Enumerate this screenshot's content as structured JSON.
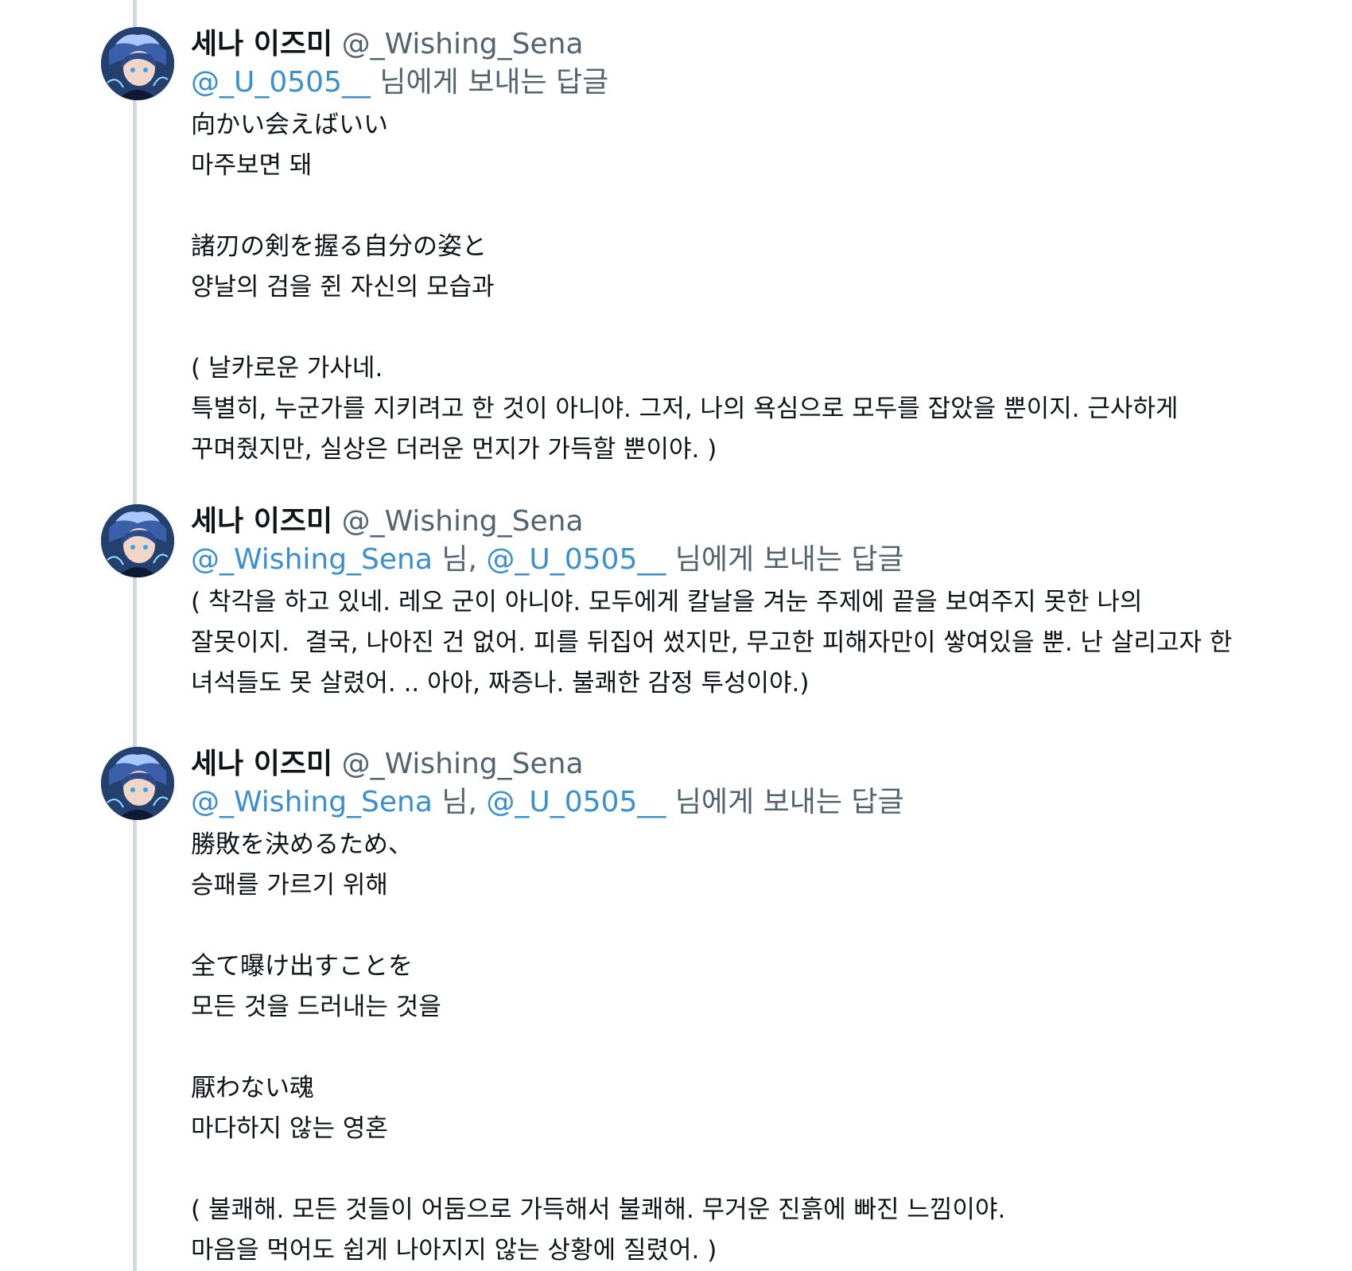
{
  "tweets": [
    {
      "display_name": "세나 이즈미",
      "handle": "@_Wishing_Sena",
      "reply_mentions": [
        {
          "text": "@_U_0505__",
          "sep": " "
        }
      ],
      "reply_suffix": "님에게 보내는 답글",
      "body": "向かい会えばいい\n마주보면 돼\n\n諸刃の剣を握る自分の姿と\n양날의 검을 쥔 자신의 모습과\n\n( 날카로운 가사네.\n특별히, 누군가를 지키려고 한 것이 아니야. 그저, 나의 욕심으로 모두를 잡았을 뿐이지. 근사하게\n꾸며줬지만, 실상은 더러운 먼지가 가득할 뿐이야. )"
    },
    {
      "display_name": "세나 이즈미",
      "handle": "@_Wishing_Sena",
      "reply_mentions": [
        {
          "text": "@_Wishing_Sena",
          "sep": " 님, "
        },
        {
          "text": "@_U_0505__",
          "sep": " "
        }
      ],
      "reply_suffix": "님에게 보내는 답글",
      "body": "( 착각을 하고 있네. 레오 군이 아니야. 모두에게 칼날을 겨눈 주제에 끝을 보여주지 못한 나의\n잘못이지.  결국, 나아진 건 없어. 피를 뒤집어 썼지만, 무고한 피해자만이 쌓여있을 뿐. 난 살리고자 한\n녀석들도 못 살렸어. .. 아아, 짜증나. 불쾌한 감정 투성이야.)"
    },
    {
      "display_name": "세나 이즈미",
      "handle": "@_Wishing_Sena",
      "reply_mentions": [
        {
          "text": "@_Wishing_Sena",
          "sep": " 님, "
        },
        {
          "text": "@_U_0505__",
          "sep": " "
        }
      ],
      "reply_suffix": "님에게 보내는 답글",
      "body": "勝敗を決めるため、\n승패를 가르기 위해\n\n全て曝け出すことを\n모든 것을 드러내는 것을\n\n厭わない魂\n마다하지 않는 영혼\n\n( 불쾌해. 모든 것들이 어둠으로 가득해서 불쾌해. 무거운 진흙에 빠진 느낌이야.\n마음을 먹어도 쉽게 나아지지 않는 상황에 질렸어. )"
    }
  ],
  "avatar_icon": "profile-avatar-icon",
  "colors": {
    "mention": "#3a8fd1",
    "secondary": "#536471",
    "thread_line": "#cfd9de",
    "text": "#0f1419"
  }
}
